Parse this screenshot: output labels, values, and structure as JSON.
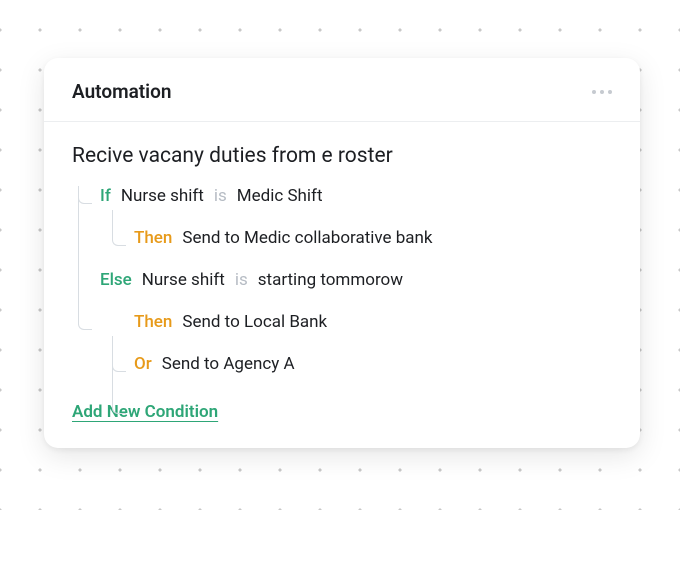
{
  "card": {
    "title": "Automation",
    "ruleTitle": "Recive vacany duties from e roster",
    "rows": {
      "if": {
        "kw": "If",
        "subject": "Nurse shift",
        "op": "is",
        "predicate": "Medic Shift"
      },
      "then1": {
        "kw": "Then",
        "action": "Send to Medic collaborative bank"
      },
      "else": {
        "kw": "Else",
        "subject": "Nurse shift",
        "op": "is",
        "predicate": "starting tommorow"
      },
      "then2": {
        "kw": "Then",
        "action": "Send to Local Bank"
      },
      "or": {
        "kw": "Or",
        "action": "Send to Agency A"
      }
    },
    "addLabel": "Add New Condition"
  }
}
